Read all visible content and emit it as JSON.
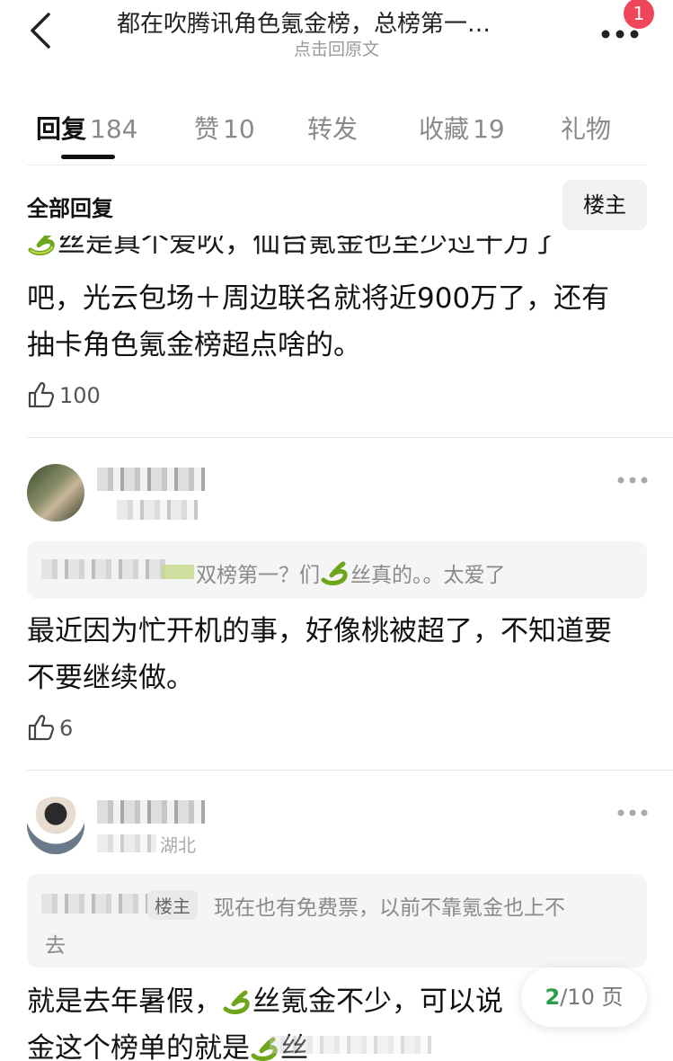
{
  "header": {
    "title": "都在吹腾讯角色氪金榜，总榜第一…",
    "subtitle": "点击回原文",
    "notification_count": "1"
  },
  "tabs": [
    {
      "label": "回复",
      "count": "184"
    },
    {
      "label": "赞",
      "count": "10"
    },
    {
      "label": "转发",
      "count": ""
    },
    {
      "label": "收藏",
      "count": "19"
    },
    {
      "label": "礼物",
      "count": ""
    }
  ],
  "filter": {
    "title": "全部回复",
    "owner_button": "楼主"
  },
  "reply1": {
    "line0": "丝是真个爱吹，仙台氪金也至少过十万了",
    "line1": "吧，光云包场＋周边联名就将近900万了，还有",
    "line2": "抽卡角色氪金榜超点啥的。",
    "likes": "100"
  },
  "reply2": {
    "quote_text": "双榜第一？们",
    "quote_text_after": "丝真的。。太爱了",
    "line1": "最近因为忙开机的事，好像桃被超了，不知道要",
    "line2": "不要继续做。",
    "likes": "6"
  },
  "reply3": {
    "location": "湖北",
    "chip": "楼主",
    "quote_line1": "现在也有免费票，以前不靠氪金也上不",
    "quote_line2": "去",
    "line1_a": "就是去年暑假，",
    "line1_b": "丝氪金不少，可以说",
    "line2_a": "金这个榜单的就是",
    "line2_b": "丝"
  },
  "pager": {
    "current": "2",
    "total": "/10 页"
  },
  "colors": {
    "accent_green": "#2a9d4a",
    "badge_red": "#f0465b",
    "text": "#111111",
    "muted": "#8a8a8a"
  },
  "icons": [
    "back-arrow-icon",
    "more-dots-icon",
    "thumbs-up-icon",
    "snake-emoji-icon"
  ]
}
